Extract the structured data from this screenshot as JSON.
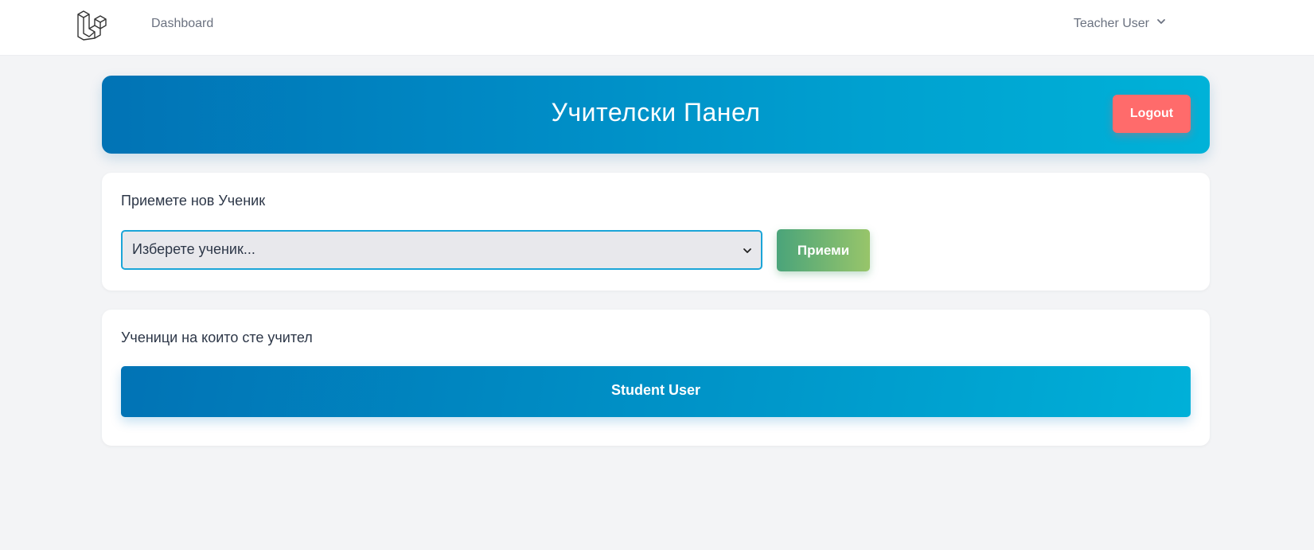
{
  "nav": {
    "logo_icon": "laravel-logo-icon",
    "dashboard_label": "Dashboard",
    "user_name": "Teacher User",
    "user_menu_icon": "chevron-down-icon"
  },
  "banner": {
    "title": "Учителски Панел",
    "logout_label": "Logout"
  },
  "accept_section": {
    "heading": "Приемете нов Ученик",
    "select_placeholder": "Изберете ученик...",
    "select_icon": "chevron-down-icon",
    "accept_label": "Приеми"
  },
  "students_section": {
    "heading": "Ученици на които сте учител",
    "students": [
      {
        "name": "Student User"
      }
    ]
  },
  "colors": {
    "page_background": "#f3f4f6",
    "banner_gradient_start": "#0173b5",
    "banner_gradient_end": "#00b2d8",
    "logout_button": "#ff6b6b",
    "accept_gradient_start": "#4aa47a",
    "accept_gradient_end": "#98c56a",
    "select_border": "#1ba5d8",
    "text_dark": "#2d3748",
    "text_muted": "#6b7280"
  }
}
